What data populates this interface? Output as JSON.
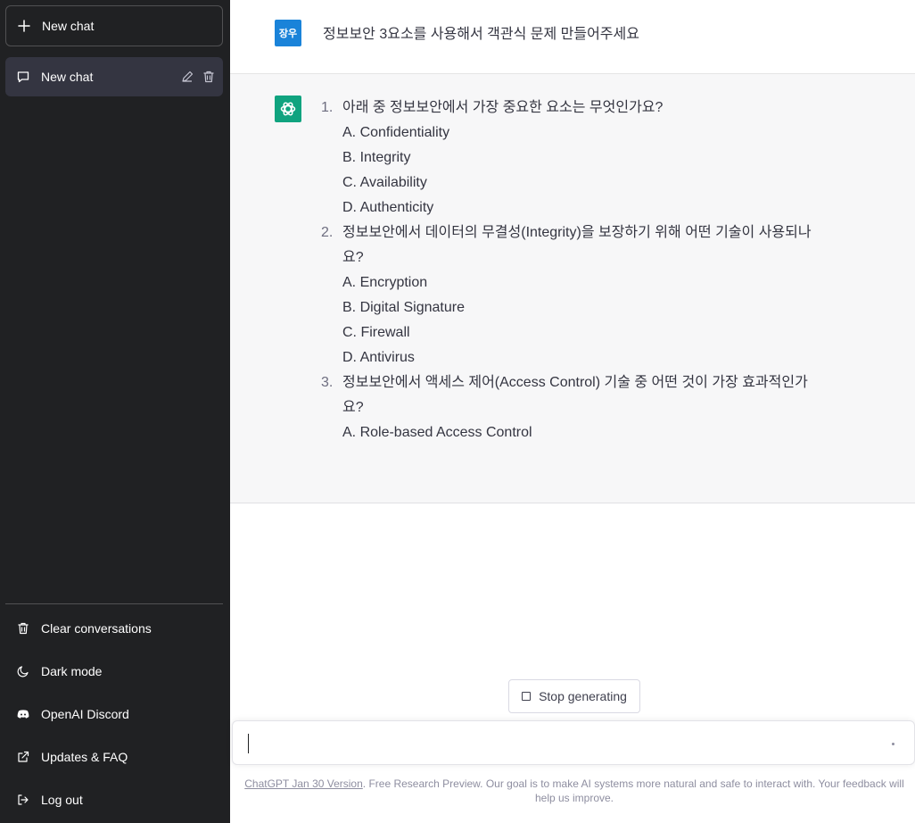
{
  "sidebar": {
    "new_chat_label": "New chat",
    "chat_item_label": "New chat",
    "menu": [
      {
        "label": "Clear conversations",
        "icon": "trash-icon"
      },
      {
        "label": "Dark mode",
        "icon": "moon-icon"
      },
      {
        "label": "OpenAI Discord",
        "icon": "discord-icon"
      },
      {
        "label": "Updates & FAQ",
        "icon": "external-link-icon"
      },
      {
        "label": "Log out",
        "icon": "logout-icon"
      }
    ]
  },
  "user_message": {
    "avatar_text": "장우",
    "text": "정보보안 3요소를 사용해서 객관식 문제 만들어주세요"
  },
  "assistant_message": {
    "questions": [
      {
        "number": "1.",
        "text": "아래 중 정보보안에서 가장 중요한 요소는 무엇인가요?",
        "options": [
          "A. Confidentiality",
          "B. Integrity",
          "C. Availability",
          "D. Authenticity"
        ]
      },
      {
        "number": "2.",
        "text": "정보보안에서 데이터의 무결성(Integrity)을 보장하기 위해 어떤 기술이 사용되나요?",
        "options": [
          "A. Encryption",
          "B. Digital Signature",
          "C. Firewall",
          "D. Antivirus"
        ]
      },
      {
        "number": "3.",
        "text": "정보보안에서 액세스 제어(Access Control) 기술 중 어떤 것이 가장 효과적인가요?",
        "options": [
          "A. Role-based Access Control"
        ]
      }
    ]
  },
  "stop_button_label": "Stop generating",
  "input": {
    "value": "",
    "placeholder": ""
  },
  "footer": {
    "link_text": "ChatGPT Jan 30 Version",
    "text": ". Free Research Preview. Our goal is to make AI systems more natural and safe to interact with. Your feedback will help us improve."
  },
  "colors": {
    "sidebar_bg": "#202123",
    "selected_item_bg": "#343541",
    "assistant_bg": "#f7f7f8",
    "assistant_avatar": "#10a37f",
    "user_avatar": "#1a83d9"
  }
}
